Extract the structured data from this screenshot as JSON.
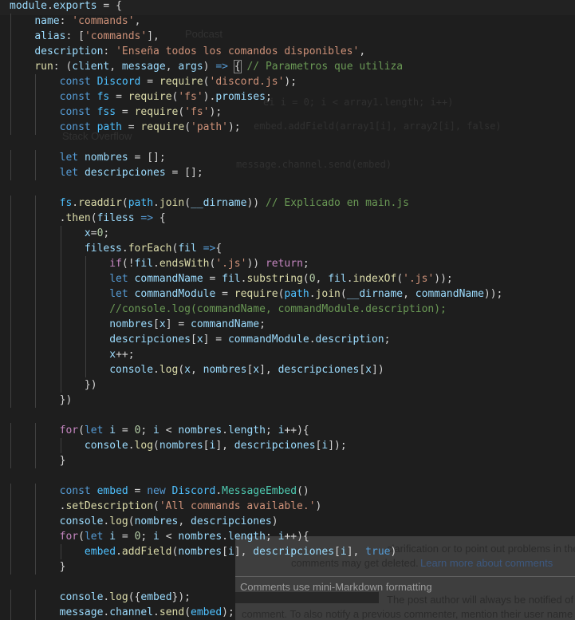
{
  "editor": {
    "language": "javascript",
    "theme_colors": {
      "background": "#1e1e1e",
      "keyword": "#569cd6",
      "control": "#c586c0",
      "variable": "#9cdcfe",
      "function": "#dcdcaa",
      "string": "#ce9178",
      "number": "#b5cea8",
      "comment": "#6a9955",
      "class": "#4ec9b0"
    },
    "lines": [
      [
        [
          "var",
          "module"
        ],
        [
          "pun",
          "."
        ],
        [
          "var",
          "exports"
        ],
        [
          "pun",
          " = {"
        ]
      ],
      [
        [
          "pun",
          "    "
        ],
        [
          "var",
          "name"
        ],
        [
          "pun",
          ": "
        ],
        [
          "str",
          "'commands'"
        ],
        [
          "pun",
          ","
        ]
      ],
      [
        [
          "pun",
          "    "
        ],
        [
          "var",
          "alias"
        ],
        [
          "pun",
          ": ["
        ],
        [
          "str",
          "'commands'"
        ],
        [
          "pun",
          "],"
        ]
      ],
      [
        [
          "pun",
          "    "
        ],
        [
          "var",
          "description"
        ],
        [
          "pun",
          ": "
        ],
        [
          "str",
          "'Enseña todos los comandos disponibles'"
        ],
        [
          "pun",
          ","
        ]
      ],
      [
        [
          "pun",
          "    "
        ],
        [
          "fn",
          "run"
        ],
        [
          "pun",
          ": ("
        ],
        [
          "var",
          "client"
        ],
        [
          "pun",
          ", "
        ],
        [
          "var",
          "message"
        ],
        [
          "pun",
          ", "
        ],
        [
          "var",
          "args"
        ],
        [
          "pun",
          ") "
        ],
        [
          "kw",
          "=>"
        ],
        [
          "pun",
          " "
        ],
        [
          "box",
          "{"
        ],
        [
          "pun",
          " "
        ],
        [
          "com",
          "// Parametros que utiliza"
        ]
      ],
      [
        [
          "pun",
          "        "
        ],
        [
          "kw",
          "const"
        ],
        [
          "pun",
          " "
        ],
        [
          "const",
          "Discord"
        ],
        [
          "pun",
          " = "
        ],
        [
          "fn",
          "require"
        ],
        [
          "pun",
          "("
        ],
        [
          "str",
          "'discord.js'"
        ],
        [
          "pun",
          ");"
        ]
      ],
      [
        [
          "pun",
          "        "
        ],
        [
          "kw",
          "const"
        ],
        [
          "pun",
          " "
        ],
        [
          "const",
          "fs"
        ],
        [
          "pun",
          " = "
        ],
        [
          "fn",
          "require"
        ],
        [
          "pun",
          "("
        ],
        [
          "str",
          "'fs'"
        ],
        [
          "pun",
          ")."
        ],
        [
          "var",
          "promises"
        ],
        [
          "pun",
          ";"
        ]
      ],
      [
        [
          "pun",
          "        "
        ],
        [
          "kw",
          "const"
        ],
        [
          "pun",
          " "
        ],
        [
          "const",
          "fss"
        ],
        [
          "pun",
          " = "
        ],
        [
          "fn",
          "require"
        ],
        [
          "pun",
          "("
        ],
        [
          "str",
          "'fs'"
        ],
        [
          "pun",
          ");"
        ]
      ],
      [
        [
          "pun",
          "        "
        ],
        [
          "kw",
          "const"
        ],
        [
          "pun",
          " "
        ],
        [
          "const",
          "path"
        ],
        [
          "pun",
          " = "
        ],
        [
          "fn",
          "require"
        ],
        [
          "pun",
          "("
        ],
        [
          "str",
          "'path'"
        ],
        [
          "pun",
          ");"
        ]
      ],
      [],
      [
        [
          "pun",
          "        "
        ],
        [
          "kw",
          "let"
        ],
        [
          "pun",
          " "
        ],
        [
          "var",
          "nombres"
        ],
        [
          "pun",
          " = [];"
        ]
      ],
      [
        [
          "pun",
          "        "
        ],
        [
          "kw",
          "let"
        ],
        [
          "pun",
          " "
        ],
        [
          "var",
          "descripciones"
        ],
        [
          "pun",
          " = [];"
        ]
      ],
      [],
      [
        [
          "pun",
          "        "
        ],
        [
          "const",
          "fs"
        ],
        [
          "pun",
          "."
        ],
        [
          "fn",
          "readdir"
        ],
        [
          "pun",
          "("
        ],
        [
          "const",
          "path"
        ],
        [
          "pun",
          "."
        ],
        [
          "fn",
          "join"
        ],
        [
          "pun",
          "("
        ],
        [
          "var",
          "__dirname"
        ],
        [
          "pun",
          "))"
        ],
        [
          "pun",
          " "
        ],
        [
          "com",
          "// Explicado en main.js"
        ]
      ],
      [
        [
          "pun",
          "        ."
        ],
        [
          "fn",
          "then"
        ],
        [
          "pun",
          "("
        ],
        [
          "var",
          "filess"
        ],
        [
          "pun",
          " "
        ],
        [
          "kw",
          "=>"
        ],
        [
          "pun",
          " {"
        ]
      ],
      [
        [
          "pun",
          "            "
        ],
        [
          "var",
          "x"
        ],
        [
          "pun",
          "="
        ],
        [
          "num",
          "0"
        ],
        [
          "pun",
          ";"
        ]
      ],
      [
        [
          "pun",
          "            "
        ],
        [
          "var",
          "filess"
        ],
        [
          "pun",
          "."
        ],
        [
          "fn",
          "forEach"
        ],
        [
          "pun",
          "("
        ],
        [
          "var",
          "fil"
        ],
        [
          "pun",
          " "
        ],
        [
          "kw",
          "=>"
        ],
        [
          "pun",
          "{"
        ]
      ],
      [
        [
          "pun",
          "                "
        ],
        [
          "ctl",
          "if"
        ],
        [
          "pun",
          "(!"
        ],
        [
          "var",
          "fil"
        ],
        [
          "pun",
          "."
        ],
        [
          "fn",
          "endsWith"
        ],
        [
          "pun",
          "("
        ],
        [
          "str",
          "'.js'"
        ],
        [
          "pun",
          ")) "
        ],
        [
          "ctl",
          "return"
        ],
        [
          "pun",
          ";"
        ]
      ],
      [
        [
          "pun",
          "                "
        ],
        [
          "kw",
          "let"
        ],
        [
          "pun",
          " "
        ],
        [
          "var",
          "commandName"
        ],
        [
          "pun",
          " = "
        ],
        [
          "var",
          "fil"
        ],
        [
          "pun",
          "."
        ],
        [
          "fn",
          "substring"
        ],
        [
          "pun",
          "("
        ],
        [
          "num",
          "0"
        ],
        [
          "pun",
          ", "
        ],
        [
          "var",
          "fil"
        ],
        [
          "pun",
          "."
        ],
        [
          "fn",
          "indexOf"
        ],
        [
          "pun",
          "("
        ],
        [
          "str",
          "'.js'"
        ],
        [
          "pun",
          "));"
        ]
      ],
      [
        [
          "pun",
          "                "
        ],
        [
          "kw",
          "let"
        ],
        [
          "pun",
          " "
        ],
        [
          "var",
          "commandModule"
        ],
        [
          "pun",
          " = "
        ],
        [
          "fn",
          "require"
        ],
        [
          "pun",
          "("
        ],
        [
          "const",
          "path"
        ],
        [
          "pun",
          "."
        ],
        [
          "fn",
          "join"
        ],
        [
          "pun",
          "("
        ],
        [
          "var",
          "__dirname"
        ],
        [
          "pun",
          ", "
        ],
        [
          "var",
          "commandName"
        ],
        [
          "pun",
          "));"
        ]
      ],
      [
        [
          "pun",
          "                "
        ],
        [
          "com",
          "//console.log(commandName, commandModule.description);"
        ]
      ],
      [
        [
          "pun",
          "                "
        ],
        [
          "var",
          "nombres"
        ],
        [
          "pun",
          "["
        ],
        [
          "var",
          "x"
        ],
        [
          "pun",
          "] = "
        ],
        [
          "var",
          "commandName"
        ],
        [
          "pun",
          ";"
        ]
      ],
      [
        [
          "pun",
          "                "
        ],
        [
          "var",
          "descripciones"
        ],
        [
          "pun",
          "["
        ],
        [
          "var",
          "x"
        ],
        [
          "pun",
          "] = "
        ],
        [
          "var",
          "commandModule"
        ],
        [
          "pun",
          "."
        ],
        [
          "var",
          "description"
        ],
        [
          "pun",
          ";"
        ]
      ],
      [
        [
          "pun",
          "                "
        ],
        [
          "var",
          "x"
        ],
        [
          "pun",
          "++;"
        ]
      ],
      [
        [
          "pun",
          "                "
        ],
        [
          "var",
          "console"
        ],
        [
          "pun",
          "."
        ],
        [
          "fn",
          "log"
        ],
        [
          "pun",
          "("
        ],
        [
          "var",
          "x"
        ],
        [
          "pun",
          ", "
        ],
        [
          "var",
          "nombres"
        ],
        [
          "pun",
          "["
        ],
        [
          "var",
          "x"
        ],
        [
          "pun",
          "], "
        ],
        [
          "var",
          "descripciones"
        ],
        [
          "pun",
          "["
        ],
        [
          "var",
          "x"
        ],
        [
          "pun",
          "])"
        ]
      ],
      [
        [
          "pun",
          "            })"
        ]
      ],
      [
        [
          "pun",
          "        })"
        ]
      ],
      [],
      [
        [
          "pun",
          "        "
        ],
        [
          "ctl",
          "for"
        ],
        [
          "pun",
          "("
        ],
        [
          "kw",
          "let"
        ],
        [
          "pun",
          " "
        ],
        [
          "var",
          "i"
        ],
        [
          "pun",
          " = "
        ],
        [
          "num",
          "0"
        ],
        [
          "pun",
          "; "
        ],
        [
          "var",
          "i"
        ],
        [
          "pun",
          " < "
        ],
        [
          "var",
          "nombres"
        ],
        [
          "pun",
          "."
        ],
        [
          "var",
          "length"
        ],
        [
          "pun",
          "; "
        ],
        [
          "var",
          "i"
        ],
        [
          "pun",
          "++){"
        ]
      ],
      [
        [
          "pun",
          "            "
        ],
        [
          "var",
          "console"
        ],
        [
          "pun",
          "."
        ],
        [
          "fn",
          "log"
        ],
        [
          "pun",
          "("
        ],
        [
          "var",
          "nombres"
        ],
        [
          "pun",
          "["
        ],
        [
          "var",
          "i"
        ],
        [
          "pun",
          "], "
        ],
        [
          "var",
          "descripciones"
        ],
        [
          "pun",
          "["
        ],
        [
          "var",
          "i"
        ],
        [
          "pun",
          "]);"
        ]
      ],
      [
        [
          "pun",
          "        }"
        ]
      ],
      [],
      [
        [
          "pun",
          "        "
        ],
        [
          "kw",
          "const"
        ],
        [
          "pun",
          " "
        ],
        [
          "const",
          "embed"
        ],
        [
          "pun",
          " = "
        ],
        [
          "kw",
          "new"
        ],
        [
          "pun",
          " "
        ],
        [
          "const",
          "Discord"
        ],
        [
          "pun",
          "."
        ],
        [
          "cls",
          "MessageEmbed"
        ],
        [
          "pun",
          "()"
        ]
      ],
      [
        [
          "pun",
          "        ."
        ],
        [
          "fn",
          "setDescription"
        ],
        [
          "pun",
          "("
        ],
        [
          "str",
          "'All commands available.'"
        ],
        [
          "pun",
          ")"
        ]
      ],
      [
        [
          "pun",
          "        "
        ],
        [
          "var",
          "console"
        ],
        [
          "pun",
          "."
        ],
        [
          "fn",
          "log"
        ],
        [
          "pun",
          "("
        ],
        [
          "var",
          "nombres"
        ],
        [
          "pun",
          ", "
        ],
        [
          "var",
          "descripciones"
        ],
        [
          "pun",
          ")"
        ]
      ],
      [
        [
          "pun",
          "        "
        ],
        [
          "ctl",
          "for"
        ],
        [
          "pun",
          "("
        ],
        [
          "kw",
          "let"
        ],
        [
          "pun",
          " "
        ],
        [
          "var",
          "i"
        ],
        [
          "pun",
          " = "
        ],
        [
          "num",
          "0"
        ],
        [
          "pun",
          "; "
        ],
        [
          "var",
          "i"
        ],
        [
          "pun",
          " < "
        ],
        [
          "var",
          "nombres"
        ],
        [
          "pun",
          "."
        ],
        [
          "var",
          "length"
        ],
        [
          "pun",
          "; "
        ],
        [
          "var",
          "i"
        ],
        [
          "pun",
          "++){"
        ]
      ],
      [
        [
          "pun",
          "            "
        ],
        [
          "const",
          "embed"
        ],
        [
          "pun",
          "."
        ],
        [
          "fn",
          "addField"
        ],
        [
          "pun",
          "("
        ],
        [
          "var",
          "nombres"
        ],
        [
          "pun",
          "["
        ],
        [
          "var",
          "i"
        ],
        [
          "pun",
          "], "
        ],
        [
          "var",
          "descripciones"
        ],
        [
          "pun",
          "["
        ],
        [
          "var",
          "i"
        ],
        [
          "pun",
          "], "
        ],
        [
          "kw",
          "true"
        ],
        [
          "pun",
          ")"
        ]
      ],
      [
        [
          "pun",
          "        }"
        ]
      ],
      [],
      [
        [
          "pun",
          "        "
        ],
        [
          "var",
          "console"
        ],
        [
          "pun",
          "."
        ],
        [
          "fn",
          "log"
        ],
        [
          "pun",
          "({"
        ],
        [
          "var",
          "embed"
        ],
        [
          "pun",
          "});"
        ]
      ],
      [
        [
          "pun",
          "        "
        ],
        [
          "var",
          "message"
        ],
        [
          "pun",
          "."
        ],
        [
          "var",
          "channel"
        ],
        [
          "pun",
          "."
        ],
        [
          "fn",
          "send"
        ],
        [
          "pun",
          "("
        ],
        [
          "const",
          "embed"
        ],
        [
          "pun",
          ");"
        ]
      ]
    ]
  },
  "background_page": {
    "faded_texts": [
      "Stack Overflow",
      "Podcast"
    ],
    "faded_code": [
      "ei i = 0; i < array1.length; i++)",
      "embed.addField(array1[i], array2[i], false)",
      "message.channel.send(embed)"
    ],
    "comment_panel": {
      "line1": "clarification or to point out problems in the",
      "line2_prefix": "comments may get deleted.",
      "line2_link": "Learn more about comments",
      "formatting_note": "Comments use mini-Markdown formatting",
      "notify_note": "The post author will always be notified of",
      "notify_note2": "comment. To also notify a previous commenter, mention their user name"
    }
  }
}
